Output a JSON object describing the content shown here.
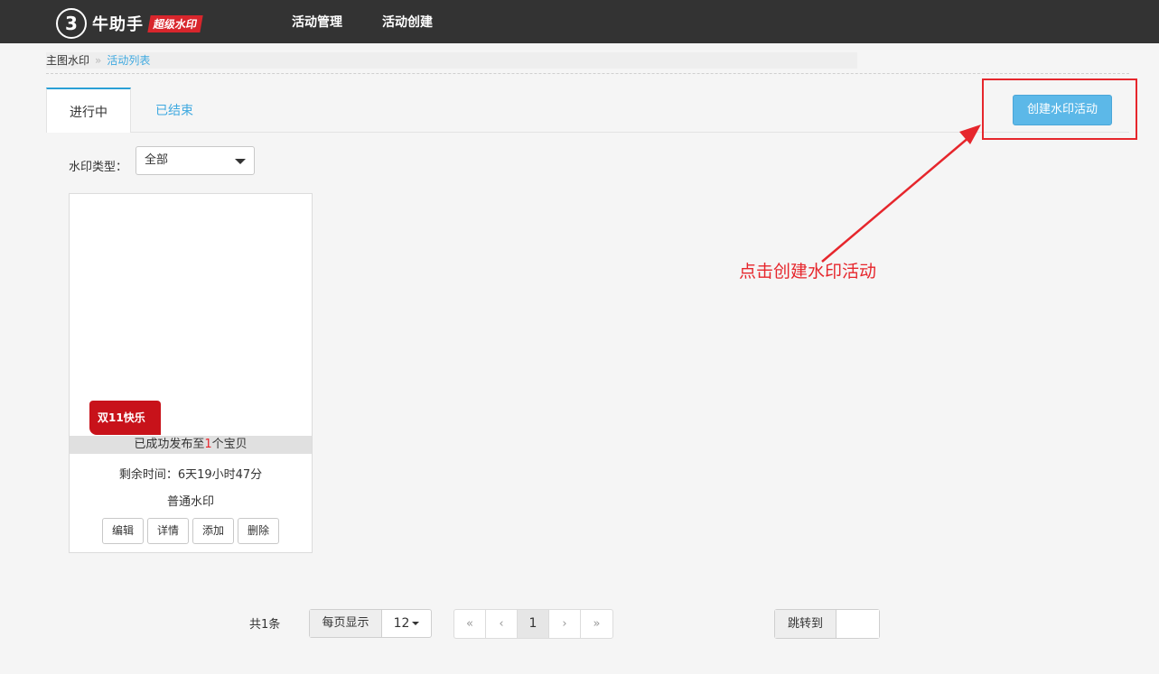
{
  "header": {
    "logo_glyph": "3",
    "app_name": "牛助手",
    "badge": "超级水印",
    "nav": [
      "活动管理",
      "活动创建"
    ]
  },
  "breadcrumb": {
    "home": "主图水印",
    "separator": "»",
    "current": "活动列表"
  },
  "tabs": {
    "active": "进行中",
    "ended": "已结束"
  },
  "create_button": "创建水印活动",
  "filter": {
    "label": "水印类型：",
    "value": "全部"
  },
  "card": {
    "watermark_tag": "双11快乐",
    "published_prefix": "已成功发布至",
    "published_count": "1",
    "published_suffix": "个宝贝",
    "remaining": "剩余时间：6天19小时47分",
    "type": "普通水印",
    "actions": [
      "编辑",
      "详情",
      "添加",
      "删除"
    ]
  },
  "annotation": "点击创建水印活动",
  "pagination": {
    "total": "共1条",
    "per_page_label": "每页显示",
    "per_page_value": "12",
    "first": "«",
    "prev": "‹",
    "current": "1",
    "next": "›",
    "last": "»",
    "jump_label": "跳转到"
  },
  "colors": {
    "topbar": "#333333",
    "accent_blue": "#5cb8e8",
    "annotation_red": "#e6262c",
    "tag_red": "#c8121a"
  }
}
